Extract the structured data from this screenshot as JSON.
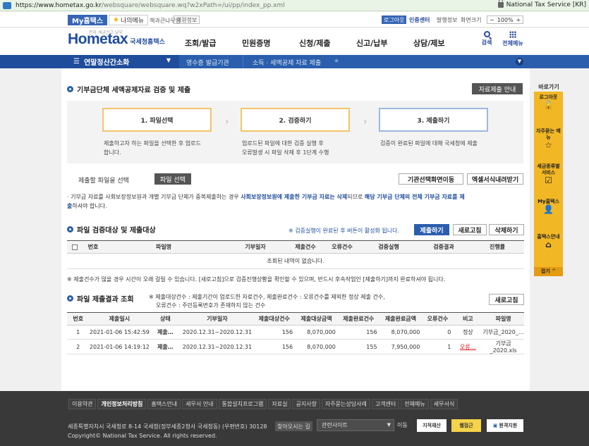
{
  "browser": {
    "url_host": "https://www.hometax.go.kr",
    "url_path": "/websquare/websquare.wq?w2xPath=/ui/pp/index_pp.xml",
    "security_label": "National Tax Service [KR]"
  },
  "util": {
    "my_hometax": "My홈택스",
    "my_menu": "나의메뉴",
    "item2": "책과큰나무님",
    "item3": "회원정보",
    "logout": "로그아웃",
    "cert_center": "인증센터",
    "item_r2": "발행정보",
    "item_r3": "화면크기",
    "zoom": "100%"
  },
  "header": {
    "logo": "Hometax",
    "logo_sub": "국세청홈택스",
    "logo_tag": "전자 세금신고 납부",
    "gnb": [
      "조회/발급",
      "민원증명",
      "신청/제출",
      "신고/납부",
      "상담/제보"
    ],
    "search_label": "검색",
    "all_menu_label": "전체메뉴"
  },
  "navbar": {
    "main": "연말정산간소화",
    "crumb1": "영수증 발급기관",
    "crumb2": "소득 · 세액공제 자료 제출"
  },
  "section1": {
    "title": "기부금단체 세액공제자료 검증 및 제출",
    "guide_button": "자료제출 안내",
    "steps": [
      {
        "label": "1. 파일선택",
        "desc1": "제출하고자 하는 파일을 선택한 후 업로드",
        "desc2": "합니다."
      },
      {
        "label": "2. 검증하기",
        "desc1": "업로드된 파일에 대한 검증 실행 후",
        "desc2": "오류발생 시 파일 삭제 후 1단계 수행"
      },
      {
        "label": "3. 제출하기",
        "desc1": "검증이 완료된 파일에 대해 국세청에 제출",
        "desc2": ""
      }
    ],
    "file_label": "제출할 파일을 선택",
    "file_button": "파일 선택",
    "org_button": "기관선택화면이동",
    "excel_button": "엑셀서식내려받기",
    "notice_a": "· 기부금 자료를 사회보장정보원과 개별 기부금 단체가 중복제출하는 경우 ",
    "notice_b": "사회보장정보원에 제출한 기부금 자료는 삭제",
    "notice_c": "되므로 ",
    "notice_d": "해당 기부금 단체의 전체 기부금 자료를 제",
    "notice_e": "출",
    "notice_f": "하셔야 합니다."
  },
  "section2": {
    "title": "파일 검증대상 및 제출대상",
    "hint": "※ 검증실행이 완료된 후 버튼이 활성화 됩니다.",
    "submit_button": "제출하기",
    "refresh_button": "새로고침",
    "delete_button": "삭제하기",
    "columns": [
      "번호",
      "파일명",
      "기부일자",
      "제출건수",
      "오류건수",
      "검증실행",
      "검증결과",
      "진행률"
    ],
    "empty_text": "조회된 내역이 없습니다.",
    "note": "※ 제출건수가 많을 경우 시간이 오래 걸릴 수 있습니다. [새로고침]으로 검증진행상황을 확인할 수 있으며, 반드시 후속작업인 [제출하기]까지 완료하셔야 됩니다."
  },
  "section3": {
    "title": "파일 제출결과 조회",
    "note1": "※ 제출대상건수 : 제출기간이 업로드한 자료건수, 제출완료건수 : 오류건수를 제외한 정상 제출 건수,",
    "note2": "오류건수 : 주민등록번호가 존재하지 않는 건수",
    "refresh_button": "새로고침",
    "columns": [
      "번호",
      "제출일시",
      "상태",
      "기부일자",
      "제출대상건수",
      "제출대상금액",
      "제출완료건수",
      "제출완료금액",
      "오류건수",
      "비고",
      "파일명"
    ],
    "rows": [
      {
        "no": "1",
        "datetime": "2021-01-06 15:42:59",
        "status": "제출…",
        "period": "2020.12.31~2020.12.31",
        "target_cnt": "156",
        "target_amt": "8,070,000",
        "done_cnt": "156",
        "done_amt": "8,070,000",
        "err_cnt": "0",
        "remark": "정상",
        "file": "기부금_2020_…"
      },
      {
        "no": "2",
        "datetime": "2021-01-06 14:19:12",
        "status": "제출…",
        "period": "2020.12.31~2020.12.31",
        "target_cnt": "156",
        "target_amt": "8,070,000",
        "done_cnt": "155",
        "done_amt": "7,950,000",
        "err_cnt": "1",
        "remark": "오류…",
        "file": "기부금_2020.xls"
      }
    ]
  },
  "quick": {
    "title": "바로가기",
    "items": [
      "로그아웃",
      "자주묻는 메뉴",
      "세금종류별 서비스",
      "My홈택스",
      "홈택스안내"
    ],
    "close": "접기"
  },
  "footer": {
    "links": [
      "이용약관",
      "개인정보처리방침",
      "홈택스안내",
      "세무서 안내",
      "통합설치프로그램",
      "자료실",
      "공지사항",
      "자주묻는상담사례",
      "고객센터",
      "전체메뉴",
      "세무서식"
    ],
    "address": "세종특별자치시 국세청로 8-14 국세청(정부세종2청사 국세청동) (우편번호) 30128",
    "copyright": "Copyright© National Tax Service. All rights reserved.",
    "find_btn": "찾아오시는 길",
    "related_select": "관련사이트",
    "go": "이동",
    "badge1": "지적재산",
    "badge2": "웹접근",
    "badge3": "원격지원"
  },
  "colors": {
    "brand_blue": "#2b5fad",
    "dark_blue": "#1f4d9b",
    "quick_yellow": "#f2b724",
    "error_red": "#d11111"
  }
}
